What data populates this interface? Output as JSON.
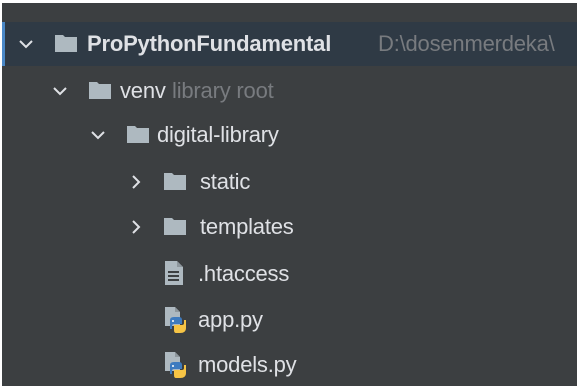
{
  "tree": {
    "items": [
      {
        "label": "ProPythonFundamental",
        "hint": "D:\\dosenmerdeka\\",
        "type": "folder",
        "expanded": true,
        "selected": true
      },
      {
        "label": "venv",
        "hint": "library root",
        "type": "folder",
        "expanded": true
      },
      {
        "label": "digital-library",
        "type": "folder",
        "expanded": true
      },
      {
        "label": "static",
        "type": "folder",
        "expanded": false
      },
      {
        "label": "templates",
        "type": "folder",
        "expanded": false
      },
      {
        "label": ".htaccess",
        "type": "text-file"
      },
      {
        "label": "app.py",
        "type": "python-file"
      },
      {
        "label": "models.py",
        "type": "python-file"
      }
    ]
  },
  "icons": {
    "folder": "folder-icon",
    "text_file": "text-file-icon",
    "python_file": "python-file-icon",
    "expanded": "chevron-down-icon",
    "collapsed": "chevron-right-icon"
  },
  "colors": {
    "background": "#3c3f41",
    "text": "#dfe1e5",
    "hint": "#787b7f",
    "folder": "#aeb9c0",
    "python_blue": "#3e7bbf",
    "python_yellow": "#f6c445",
    "selection": "#2f3a45"
  }
}
